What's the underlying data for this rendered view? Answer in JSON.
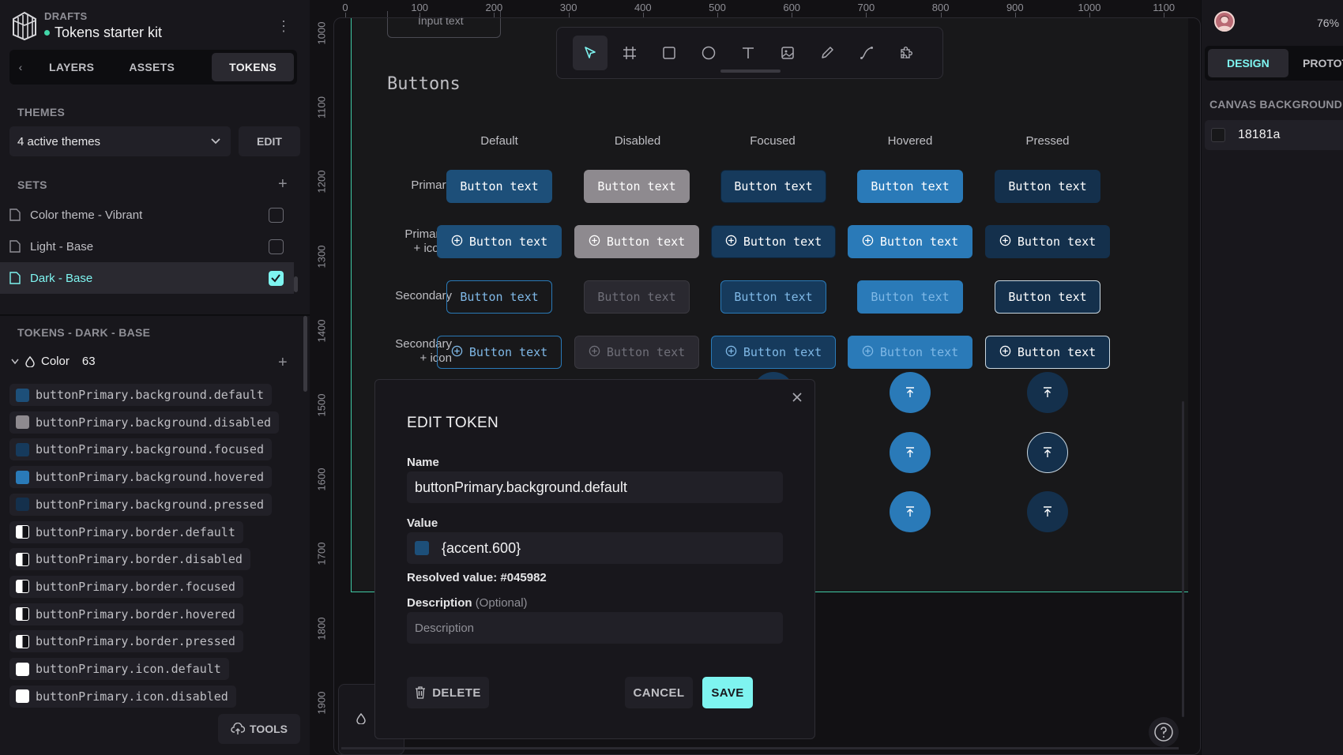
{
  "project": {
    "drafts_label": "DRAFTS",
    "name": "Tokens starter kit"
  },
  "left_tabs": {
    "back": "‹",
    "layers": "LAYERS",
    "assets": "ASSETS",
    "tokens": "TOKENS"
  },
  "themes": {
    "label": "THEMES",
    "selected": "4 active themes",
    "edit": "EDIT"
  },
  "sets": {
    "label": "SETS",
    "items": [
      {
        "name": "Color theme - Vibrant",
        "checked": false
      },
      {
        "name": "Light - Base",
        "checked": false
      },
      {
        "name": "Dark - Base",
        "checked": true
      }
    ]
  },
  "tokens_section": {
    "label": "TOKENS - DARK - BASE",
    "group_name": "Color",
    "group_count": "63",
    "items": [
      {
        "name": "buttonPrimary.background.default",
        "color": "#1d4f79"
      },
      {
        "name": "buttonPrimary.background.disabled",
        "color": "#8e8a8f"
      },
      {
        "name": "buttonPrimary.background.focused",
        "color": "#163a5c"
      },
      {
        "name": "buttonPrimary.background.hovered",
        "color": "#2a7ab8"
      },
      {
        "name": "buttonPrimary.background.pressed",
        "color": "#14304c"
      },
      {
        "name": "buttonPrimary.border.default",
        "color": "split"
      },
      {
        "name": "buttonPrimary.border.disabled",
        "color": "split"
      },
      {
        "name": "buttonPrimary.border.focused",
        "color": "split"
      },
      {
        "name": "buttonPrimary.border.hovered",
        "color": "split"
      },
      {
        "name": "buttonPrimary.border.pressed",
        "color": "split"
      },
      {
        "name": "buttonPrimary.icon.default",
        "color": "#ffffff"
      },
      {
        "name": "buttonPrimary.icon.disabled",
        "color": "#ffffff"
      }
    ]
  },
  "tools_label": "TOOLS",
  "canvas": {
    "ruler_x": [
      "0",
      "100",
      "200",
      "300",
      "400",
      "500",
      "600",
      "700",
      "800",
      "900",
      "1000",
      "1100"
    ],
    "ruler_y": [
      "1000",
      "1100",
      "1200",
      "1300",
      "1400",
      "1500",
      "1600",
      "1700",
      "1800",
      "1900"
    ],
    "input_stub_text": "Input text",
    "board_title": "Buttons",
    "columns": [
      "Default",
      "Disabled",
      "Focused",
      "Hovered",
      "Pressed"
    ],
    "rows": [
      {
        "label_line1": "Primary",
        "label_line2": ""
      },
      {
        "label_line1": "Primary",
        "label_line2": "+ icon"
      },
      {
        "label_line1": "Secondary",
        "label_line2": ""
      },
      {
        "label_line1": "Secondary",
        "label_line2": "+ icon"
      }
    ],
    "button_text": "Button text",
    "colors": {
      "primary_default": "#1d4f79",
      "primary_disabled": "#8e8a8f",
      "primary_focused": "#163a5c",
      "primary_hovered": "#2a7ab8",
      "primary_pressed": "#14304c",
      "accent": "#3fc9a4",
      "highlight": "#7ef4f0"
    }
  },
  "edit_token": {
    "title": "EDIT TOKEN",
    "name_label": "Name",
    "name_value": "buttonPrimary.background.default",
    "value_label": "Value",
    "value": "{accent.600}",
    "resolved": "Resolved value: #045982",
    "description_label": "Description",
    "description_optional": "(Optional)",
    "description_placeholder": "Description",
    "delete": "DELETE",
    "cancel": "CANCEL",
    "save": "SAVE"
  },
  "right_panel": {
    "zoom": "76%",
    "tab_design": "DESIGN",
    "tab_prototype": "PROTOTYPE",
    "canvas_bg_label": "CANVAS BACKGROUND",
    "canvas_bg_value": "18181a"
  }
}
